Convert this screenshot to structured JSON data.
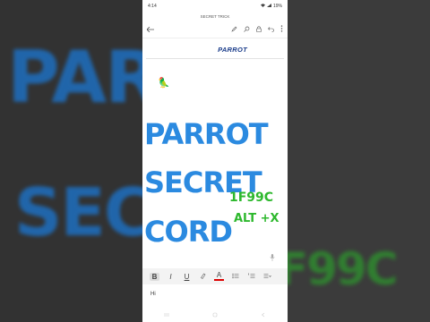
{
  "background": {
    "line1": "PAR",
    "line2": "SEC",
    "line3": "F99C"
  },
  "status_bar": {
    "time": "4:14",
    "battery": "19%"
  },
  "app": {
    "title": "SECRET TRICK"
  },
  "toolbar": {
    "back_icon": "arrow-left-icon",
    "icons": [
      "pen-icon",
      "search-icon",
      "lock-icon",
      "undo-icon",
      "more-icon"
    ]
  },
  "document": {
    "header_text": "PARROT",
    "emoji": "🦜",
    "overlay_lines": [
      "PARROT",
      "SECRET",
      "CORD"
    ],
    "code_text": "1F99C",
    "shortcut_text": "ALT +X"
  },
  "format_bar": {
    "bold": "B",
    "italic": "I",
    "underline": "U",
    "font_color": "A"
  },
  "reply_text": "Hi",
  "colors": {
    "overlay_blue": "#2b8ae0",
    "overlay_green": "#2db82d",
    "header_blue": "#1a3c8a"
  }
}
